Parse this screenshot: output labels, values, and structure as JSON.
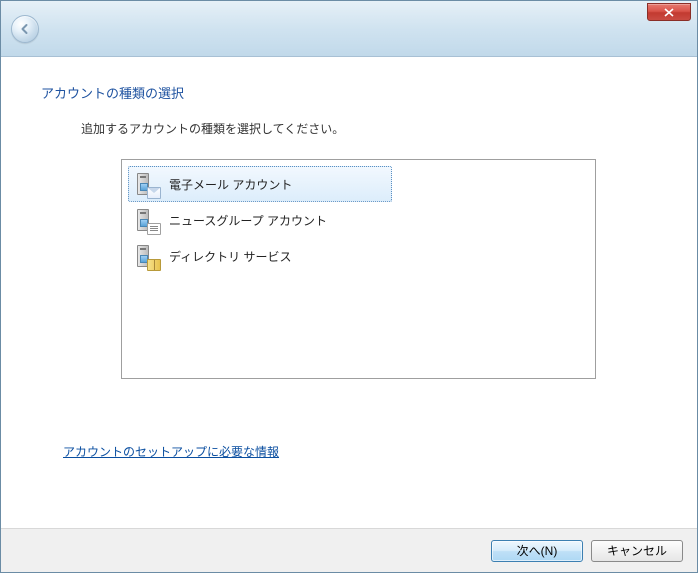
{
  "heading": "アカウントの種類の選択",
  "instruction": "追加するアカウントの種類を選択してください。",
  "options": [
    {
      "label": "電子メール アカウント",
      "icon": "email-account-icon",
      "selected": true
    },
    {
      "label": "ニュースグループ アカウント",
      "icon": "newsgroup-account-icon",
      "selected": false
    },
    {
      "label": "ディレクトリ サービス",
      "icon": "directory-service-icon",
      "selected": false
    }
  ],
  "help_link": "アカウントのセットアップに必要な情報",
  "buttons": {
    "next": "次へ(N)",
    "cancel": "キャンセル"
  }
}
